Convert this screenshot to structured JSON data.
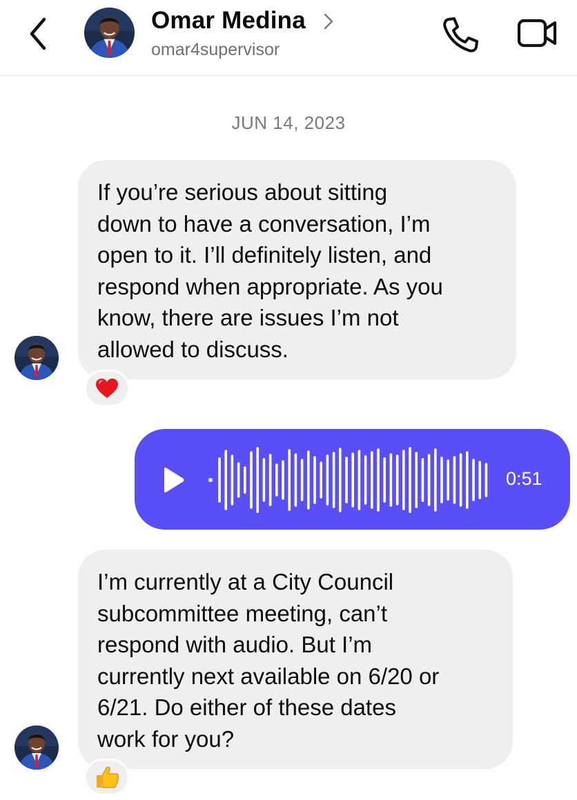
{
  "header": {
    "contact_name": "Omar Medina",
    "contact_handle": "omar4supervisor"
  },
  "thread": {
    "date_separator": "JUN 14, 2023",
    "messages": [
      {
        "sender": "Omar Medina",
        "type": "text",
        "lines": [
          "If you’re serious about sitting",
          "down to have a conversation, I’m",
          "open to it. I’ll definitely listen, and",
          "respond when appropriate. As you",
          "know, there are issues I’m not",
          "allowed to discuss."
        ],
        "reaction": "❤️"
      },
      {
        "sender": "me",
        "type": "voice",
        "duration": "0:51"
      },
      {
        "sender": "Omar Medina",
        "type": "text",
        "lines": [
          "I’m currently at a City Council",
          "subcommittee meeting, can’t",
          "respond with audio. But I’m",
          "currently next available on 6/20 or",
          "6/21. Do either of these dates",
          "work for you?"
        ],
        "reaction": "👍"
      }
    ]
  },
  "icons": {
    "back": "chevron-left-icon",
    "name_chevron": "chevron-right-icon",
    "call": "phone-icon",
    "video": "video-camera-icon",
    "play": "play-icon"
  },
  "colors": {
    "sent_bubble": "#5a4ff6",
    "received_bubble": "#efefef",
    "secondary_text": "#707070"
  }
}
